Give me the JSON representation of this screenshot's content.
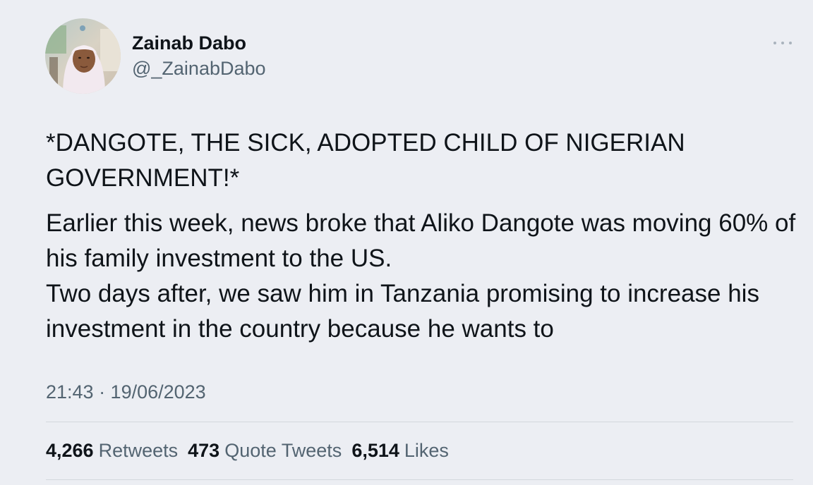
{
  "author": {
    "display_name": "Zainab Dabo",
    "handle": "@_ZainabDabo"
  },
  "tweet": {
    "paragraphs": [
      "*DANGOTE, THE SICK, ADOPTED CHILD OF NIGERIAN GOVERNMENT!*",
      "Earlier this week, news broke that Aliko Dangote was moving 60% of his family investment to the US.",
      "Two days after, we saw him in Tanzania promising to increase his investment in the country because he wants to"
    ],
    "timestamp": "21:43 · 19/06/2023"
  },
  "stats": {
    "retweets": {
      "count": "4,266",
      "label": "Retweets"
    },
    "quote_tweets": {
      "count": "473",
      "label": "Quote Tweets"
    },
    "likes": {
      "count": "6,514",
      "label": "Likes"
    }
  },
  "icons": {
    "more": "more-horizontal-icon"
  },
  "colors": {
    "background": "#eceef3",
    "primary_text": "#0f1419",
    "secondary_text": "#536471",
    "divider": "#d3d8dd"
  }
}
